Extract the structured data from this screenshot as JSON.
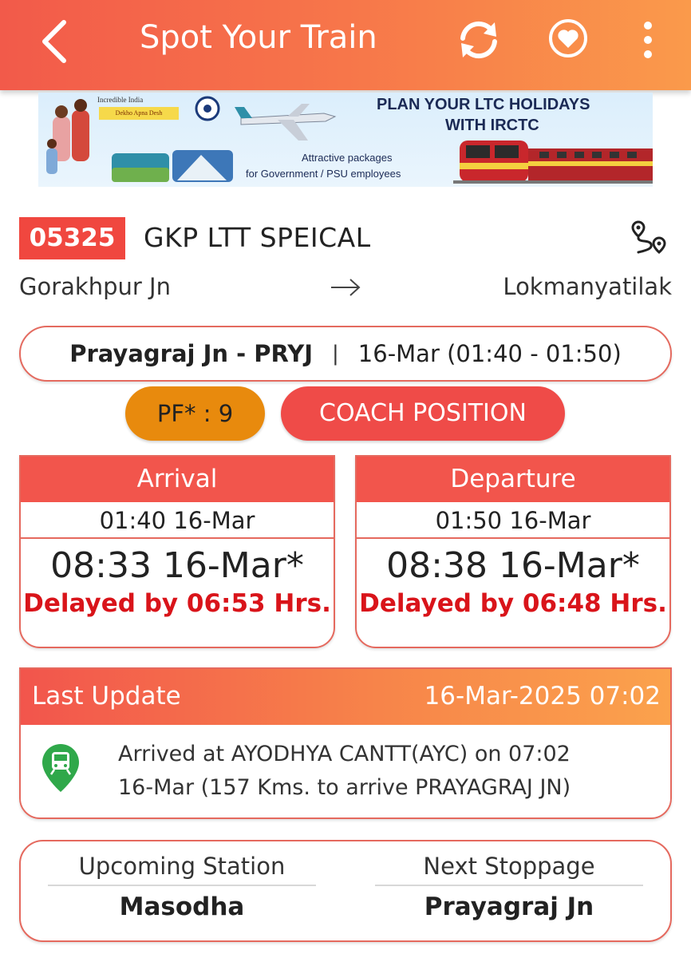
{
  "header": {
    "title": "Spot Your Train",
    "back_icon": "chevron-left-icon",
    "refresh_icon": "refresh-icon",
    "favorite_icon": "heart-icon",
    "more_icon": "more-vertical-icon",
    "colors": {
      "gradient_start": "#f25a4a",
      "gradient_end": "#fa9a4b"
    }
  },
  "banner": {
    "line1": "PLAN YOUR LTC HOLIDAYS",
    "line2": "WITH IRCTC",
    "sub1": "Attractive packages",
    "sub2": "for Government / PSU employees",
    "tag1": "Incredible India",
    "tag2": "Dekho Apna Desh"
  },
  "train": {
    "number": "05325",
    "name": "GKP LTT SPEICAL",
    "from": "Gorakhpur Jn",
    "to": "Lokmanyatilak",
    "route_icon": "route-map-icon"
  },
  "station": {
    "name": "Prayagraj Jn - PRYJ",
    "separator": "|",
    "time": "16-Mar (01:40 - 01:50)"
  },
  "actions": {
    "platform": "PF* : 9",
    "coach_position": "COACH POSITION"
  },
  "arrival": {
    "label": "Arrival",
    "scheduled": "01:40 16-Mar",
    "actual": "08:33 16-Mar*",
    "delay": "Delayed by 06:53 Hrs."
  },
  "departure": {
    "label": "Departure",
    "scheduled": "01:50 16-Mar",
    "actual": "08:38 16-Mar*",
    "delay": "Delayed by 06:48 Hrs."
  },
  "last_update": {
    "label": "Last Update",
    "timestamp": "16-Mar-2025 07:02",
    "line1": "Arrived at AYODHYA CANTT(AYC) on 07:02",
    "line2": "16-Mar (157 Kms. to arrive PRAYAGRAJ JN)",
    "icon": "train-location-pin-icon"
  },
  "upcoming": {
    "upcoming_label": "Upcoming Station",
    "upcoming_value": "Masodha",
    "next_label": "Next Stoppage",
    "next_value": "Prayagraj Jn"
  }
}
